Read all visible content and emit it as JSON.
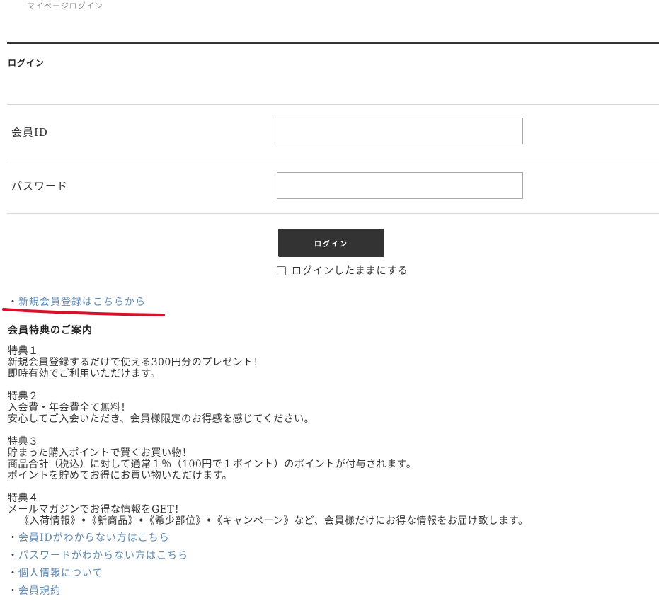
{
  "breadcrumb": "マイページログイン",
  "login_section": {
    "title": "ログイン",
    "member_id_label": "会員ID",
    "password_label": "パスワード",
    "login_button": "ログイン",
    "remember_label": "ログインしたままにする",
    "register_link": "新規会員登録はこちらから"
  },
  "benefits_heading": "会員特典のご案内",
  "benefits": [
    {
      "title": "特典１",
      "lines": [
        "新規会員登録するだけで使える300円分のプレゼント！",
        "即時有効でご利用いただけます。"
      ]
    },
    {
      "title": "特典２",
      "lines": [
        "入会費・年会費全て無料！",
        "安心してご入会いただき、会員様限定のお得感を感じてください。"
      ]
    },
    {
      "title": "特典３",
      "lines": [
        "貯まった購入ポイントで賢くお買い物！",
        "商品合計（税込）に対して通常１％（100円で１ポイント）のポイントが付与されます。",
        "ポイントを貯めてお得にお買い物いただけます。"
      ]
    },
    {
      "title": "特典４",
      "lines": [
        "メールマガジンでお得な情報をGET！",
        "《入荷情報》•《新商品》•《希少部位》•《キャンペーン》など、会員様だけにお得な情報をお届け致します。"
      ]
    }
  ],
  "bottom_links": [
    "会員IDがわからない方はこちら",
    "パスワードがわからない方はこちら",
    "個人情報について",
    "会員規約"
  ],
  "bullet": "・",
  "colors": {
    "link": "#5e8bb8",
    "button_bg": "#333333",
    "annotation": "#d8102a"
  }
}
